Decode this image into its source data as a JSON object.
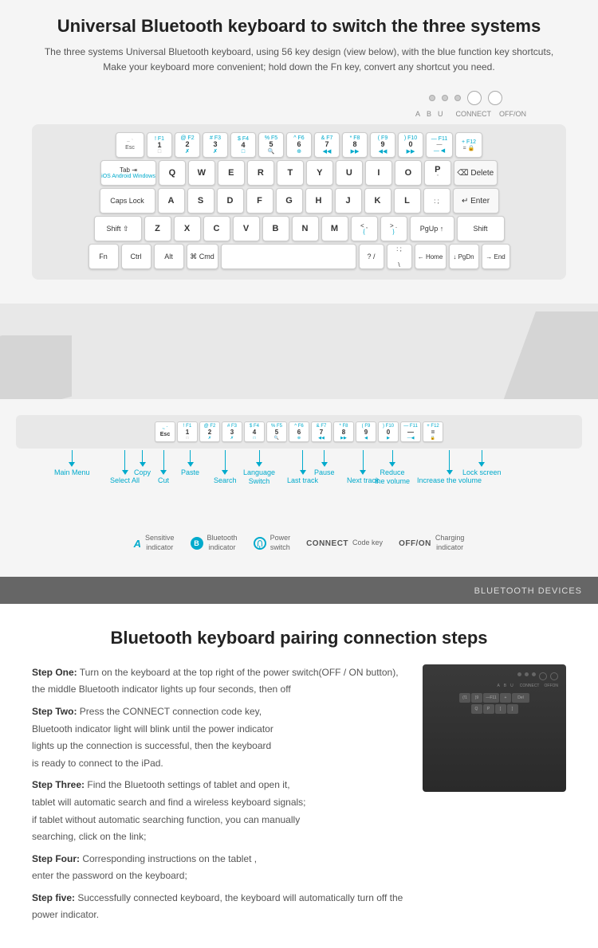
{
  "page": {
    "section1": {
      "title": "Universal Bluetooth keyboard to switch the three systems",
      "description": "The three systems Universal Bluetooth keyboard, using 56 key design (view below), with the blue function key shortcuts,\nMake your keyboard more convenient; hold down the Fn key, convert any shortcut you need.",
      "indicators": {
        "labels": [
          "A",
          "B",
          "U",
          "CONNECT",
          "OFF/ON"
        ]
      }
    },
    "section2": {
      "function_labels": [
        {
          "text": "Main Menu",
          "left": "60"
        },
        {
          "text": "Copy",
          "left": "145"
        },
        {
          "text": "Paste",
          "left": "220"
        },
        {
          "text": "Language\nSwitch",
          "left": "310"
        },
        {
          "text": "Pause",
          "left": "395"
        },
        {
          "text": "Reduce\nthe volume",
          "left": "468"
        },
        {
          "text": "Lock screen",
          "left": "565"
        },
        {
          "text": "Select All",
          "left": "105"
        },
        {
          "text": "Cut",
          "left": "192"
        },
        {
          "text": "Search",
          "left": "270"
        },
        {
          "text": "Last track",
          "left": "358"
        },
        {
          "text": "Next track",
          "left": "440"
        },
        {
          "text": "Increase the volume",
          "left": "520"
        }
      ],
      "legend": [
        {
          "icon": "A",
          "label": "Sensitive\nindicator"
        },
        {
          "icon": "BT",
          "label": "Bluetooth\nindicator"
        },
        {
          "icon": "PWR",
          "label": "Power\nswitch"
        },
        {
          "icon": "CONNECT",
          "label": "Code key"
        },
        {
          "icon": "OFF/ON",
          "label": "Charging\nindicator"
        }
      ]
    },
    "bluetooth_banner": {
      "text": "BLUETOOTH DEVICES"
    },
    "section3": {
      "title": "Bluetooth keyboard pairing connection steps",
      "steps": [
        {
          "label": "Step One:",
          "text": "Turn on the keyboard at the top right of the power switch(OFF / ON button),\nthe middle Bluetooth indicator lights up four seconds, then off"
        },
        {
          "label": "Step Two:",
          "text": "Press the CONNECT connection code key,\nBluetooth indicator light will blink until the power indicator\nlights up the connection is successful, then the keyboard\nis ready to connect to the iPad."
        },
        {
          "label": "Step Three:",
          "text": "Find the Bluetooth settings of tablet and open it,\ntablet will automatic search and find a wireless keyboard signals;\nif tablet without automatic searching function, you can manually\nsearching, click on the link;"
        },
        {
          "label": "Step Four:",
          "text": "Corresponding instructions on the tablet ,\nenter the password on the keyboard;"
        },
        {
          "label": "Step five:",
          "text": "Successfully connected keyboard, the keyboard will automatically turn off the power indicator."
        }
      ]
    }
  }
}
